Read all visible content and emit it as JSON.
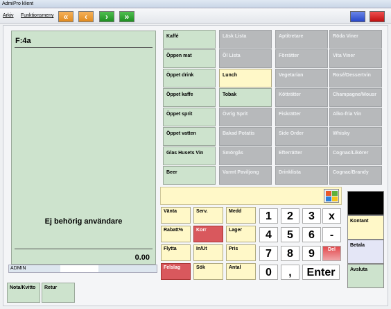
{
  "window": {
    "title": "AdmiPro klient"
  },
  "menu": {
    "arkiv": "Arkiv",
    "funktionsmeny": "Funktionsmeny"
  },
  "receipt": {
    "header": "F:4a",
    "message": "Ej behörig användare",
    "total": "0.00"
  },
  "user": {
    "name": "ADMIN"
  },
  "bottom_buttons": [
    "Nota/Kvitto",
    "Retur"
  ],
  "categories": [
    {
      "label": "Kaffé",
      "style": "green"
    },
    {
      "label": "Läsk Lista",
      "style": "grey"
    },
    {
      "label": "Aptitretare",
      "style": "grey"
    },
    {
      "label": "Röda Viner",
      "style": "grey"
    },
    {
      "label": "Öppen mat",
      "style": "green"
    },
    {
      "label": "Öl Lista",
      "style": "grey"
    },
    {
      "label": "Förrätter",
      "style": "grey"
    },
    {
      "label": "Vita Viner",
      "style": "grey"
    },
    {
      "label": "Öppet drink",
      "style": "green"
    },
    {
      "label": "Lunch",
      "style": "yellow"
    },
    {
      "label": "Vegetarian",
      "style": "grey"
    },
    {
      "label": "Rosé/Dessertvin",
      "style": "grey"
    },
    {
      "label": "Öppet kaffe",
      "style": "green"
    },
    {
      "label": "Tobak",
      "style": "lgreen"
    },
    {
      "label": "Kötträtter",
      "style": "grey"
    },
    {
      "label": "Champagne/Mousr",
      "style": "grey"
    },
    {
      "label": "Öppet sprit",
      "style": "green"
    },
    {
      "label": "Övrig Sprit",
      "style": "grey"
    },
    {
      "label": "Fiskrätter",
      "style": "grey"
    },
    {
      "label": "Alko-fria Vin",
      "style": "grey"
    },
    {
      "label": "Öppet vatten",
      "style": "green"
    },
    {
      "label": "Bakad Potatis",
      "style": "grey"
    },
    {
      "label": "Side Order",
      "style": "grey"
    },
    {
      "label": "Whisky",
      "style": "grey"
    },
    {
      "label": "Glas Husets Vin",
      "style": "green"
    },
    {
      "label": "Smörgås",
      "style": "grey"
    },
    {
      "label": "Efterrätter",
      "style": "grey"
    },
    {
      "label": "Cognac/Likörer",
      "style": "grey"
    },
    {
      "label": "Beer",
      "style": "green"
    },
    {
      "label": "Varmt Paviljong",
      "style": "grey"
    },
    {
      "label": "Drinklista",
      "style": "grey"
    },
    {
      "label": "Cognac/Brandy",
      "style": "grey"
    }
  ],
  "actions": [
    {
      "label": "Vänta",
      "style": "yellow"
    },
    {
      "label": "Serv.",
      "style": "yellow"
    },
    {
      "label": "Medd",
      "style": "yellow"
    },
    {
      "label": "Rabatt%",
      "style": "yellow"
    },
    {
      "label": "Korr",
      "style": "red"
    },
    {
      "label": "Lager",
      "style": "yellow"
    },
    {
      "label": "Flytta",
      "style": "yellow"
    },
    {
      "label": "In/Ut",
      "style": "yellow"
    },
    {
      "label": "Pris",
      "style": "yellow"
    },
    {
      "label": "Felslag",
      "style": "red"
    },
    {
      "label": "Sök",
      "style": "yellow"
    },
    {
      "label": "Antal",
      "style": "yellow"
    }
  ],
  "keypad": [
    "1",
    "2",
    "3",
    "x",
    "4",
    "5",
    "6",
    "-",
    "7",
    "8",
    "9",
    "Del",
    "0",
    ",",
    "Enter"
  ],
  "side_buttons": [
    {
      "label": "",
      "color": "#000000"
    },
    {
      "label": "Kontant",
      "color": "#fff8c8"
    },
    {
      "label": "Betala",
      "color": "#e4e6f6"
    },
    {
      "label": "Avsluta",
      "color": "#cde3cd"
    }
  ],
  "colors": {
    "receipt_bg": "#cde3cd",
    "disabled": "#b7b9bb",
    "accent_yellow": "#fff8c8",
    "accent_red": "#d9585d"
  },
  "icons": {
    "nav": [
      "double-left-arrow-icon",
      "left-arrow-icon",
      "right-arrow-icon",
      "double-right-arrow-icon"
    ],
    "windows": [
      "minimize-window-icon",
      "close-window-icon"
    ]
  }
}
